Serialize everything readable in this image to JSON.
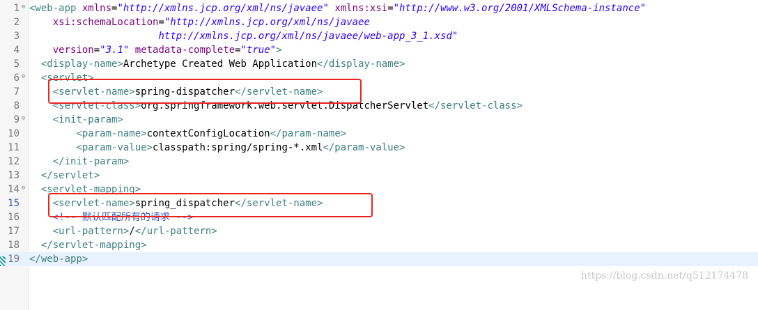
{
  "editor": {
    "lines": [
      {
        "n": "1",
        "fold": "⊖",
        "tokens": [
          {
            "t": "<web-app ",
            "c": "tag"
          },
          {
            "t": "xmlns",
            "c": "attr"
          },
          {
            "t": "=",
            "c": "txt"
          },
          {
            "t": "\"http://xmlns.jcp.org/xml/ns/javaee\"",
            "c": "str"
          },
          {
            "t": " ",
            "c": "txt"
          },
          {
            "t": "xmlns:xsi",
            "c": "attr"
          },
          {
            "t": "=",
            "c": "txt"
          },
          {
            "t": "\"http://www.w3.org/2001/XMLSchema-instance\"",
            "c": "str"
          }
        ]
      },
      {
        "n": "2",
        "fold": "",
        "tokens": [
          {
            "t": "    ",
            "c": "txt"
          },
          {
            "t": "xsi:schemaLocation",
            "c": "attr"
          },
          {
            "t": "=",
            "c": "txt"
          },
          {
            "t": "\"http://xmlns.jcp.org/xml/ns/javaee",
            "c": "str"
          }
        ]
      },
      {
        "n": "3",
        "fold": "",
        "tokens": [
          {
            "t": "                      ",
            "c": "txt"
          },
          {
            "t": "http://xmlns.jcp.org/xml/ns/javaee/web-app_3_1.xsd\"",
            "c": "str"
          }
        ]
      },
      {
        "n": "4",
        "fold": "",
        "tokens": [
          {
            "t": "    ",
            "c": "txt"
          },
          {
            "t": "version",
            "c": "attr"
          },
          {
            "t": "=",
            "c": "txt"
          },
          {
            "t": "\"3.1\"",
            "c": "str"
          },
          {
            "t": " ",
            "c": "txt"
          },
          {
            "t": "metadata-complete",
            "c": "attr"
          },
          {
            "t": "=",
            "c": "txt"
          },
          {
            "t": "\"true\"",
            "c": "str"
          },
          {
            "t": ">",
            "c": "tag"
          }
        ]
      },
      {
        "n": "5",
        "fold": "",
        "tokens": [
          {
            "t": "  ",
            "c": "txt"
          },
          {
            "t": "<display-name>",
            "c": "tag"
          },
          {
            "t": "Archetype Created Web Application",
            "c": "txt"
          },
          {
            "t": "</display-name>",
            "c": "tag"
          }
        ]
      },
      {
        "n": "6",
        "fold": "⊖",
        "tokens": [
          {
            "t": "  ",
            "c": "txt"
          },
          {
            "t": "<servlet>",
            "c": "tag"
          }
        ]
      },
      {
        "n": "7",
        "fold": "",
        "tokens": [
          {
            "t": "    ",
            "c": "txt"
          },
          {
            "t": "<servlet-name>",
            "c": "tag"
          },
          {
            "t": "spring-dispatcher",
            "c": "txt"
          },
          {
            "t": "</servlet-name>",
            "c": "tag"
          }
        ]
      },
      {
        "n": "8",
        "fold": "",
        "tokens": [
          {
            "t": "    ",
            "c": "txt"
          },
          {
            "t": "<servlet-class>",
            "c": "tag"
          },
          {
            "t": "org.springframework.web.servlet.DispatcherServlet",
            "c": "txt"
          },
          {
            "t": "</servlet-class>",
            "c": "tag"
          }
        ]
      },
      {
        "n": "9",
        "fold": "⊖",
        "tokens": [
          {
            "t": "    ",
            "c": "txt"
          },
          {
            "t": "<init-param>",
            "c": "tag"
          }
        ]
      },
      {
        "n": "10",
        "fold": "",
        "tokens": [
          {
            "t": "        ",
            "c": "txt"
          },
          {
            "t": "<param-name>",
            "c": "tag"
          },
          {
            "t": "contextConfigLocation",
            "c": "txt"
          },
          {
            "t": "</param-name>",
            "c": "tag"
          }
        ]
      },
      {
        "n": "11",
        "fold": "",
        "tokens": [
          {
            "t": "        ",
            "c": "txt"
          },
          {
            "t": "<param-value>",
            "c": "tag"
          },
          {
            "t": "classpath:spring/spring-*.xml",
            "c": "txt"
          },
          {
            "t": "</param-value>",
            "c": "tag"
          }
        ]
      },
      {
        "n": "12",
        "fold": "",
        "tokens": [
          {
            "t": "    ",
            "c": "txt"
          },
          {
            "t": "</init-param>",
            "c": "tag"
          }
        ]
      },
      {
        "n": "13",
        "fold": "",
        "tokens": [
          {
            "t": "  ",
            "c": "txt"
          },
          {
            "t": "</servlet>",
            "c": "tag"
          }
        ]
      },
      {
        "n": "14",
        "fold": "⊖",
        "tokens": [
          {
            "t": "  ",
            "c": "txt"
          },
          {
            "t": "<servlet-mapping>",
            "c": "tag"
          }
        ]
      },
      {
        "n": "15",
        "fold": "",
        "tokens": [
          {
            "t": "    ",
            "c": "txt"
          },
          {
            "t": "<servlet-name>",
            "c": "tag"
          },
          {
            "t": "spring_dispatcher",
            "c": "txt"
          },
          {
            "t": "</servlet-name>",
            "c": "tag"
          }
        ]
      },
      {
        "n": "16",
        "fold": "",
        "tokens": [
          {
            "t": "    ",
            "c": "txt"
          },
          {
            "t": "<!-- 默认匹配所有的请求 -->",
            "c": "cmt"
          }
        ]
      },
      {
        "n": "17",
        "fold": "",
        "tokens": [
          {
            "t": "    ",
            "c": "txt"
          },
          {
            "t": "<url-pattern>",
            "c": "tag"
          },
          {
            "t": "/",
            "c": "txt"
          },
          {
            "t": "</url-pattern>",
            "c": "tag"
          }
        ]
      },
      {
        "n": "18",
        "fold": "",
        "tokens": [
          {
            "t": "  ",
            "c": "txt"
          },
          {
            "t": "</servlet-mapping>",
            "c": "tag"
          }
        ]
      },
      {
        "n": "19",
        "fold": "",
        "tokens": [
          {
            "t": "</web-app>",
            "c": "tag"
          }
        ]
      }
    ]
  },
  "watermark": "https://blog.csdn.net/q512174478",
  "colors": {
    "highlight_box": "#e8231f",
    "tag": "#3f7f7f",
    "attribute": "#7f007f",
    "string": "#2a00ff",
    "comment": "#3f5fbf",
    "current_line": "#e8f2fe"
  }
}
